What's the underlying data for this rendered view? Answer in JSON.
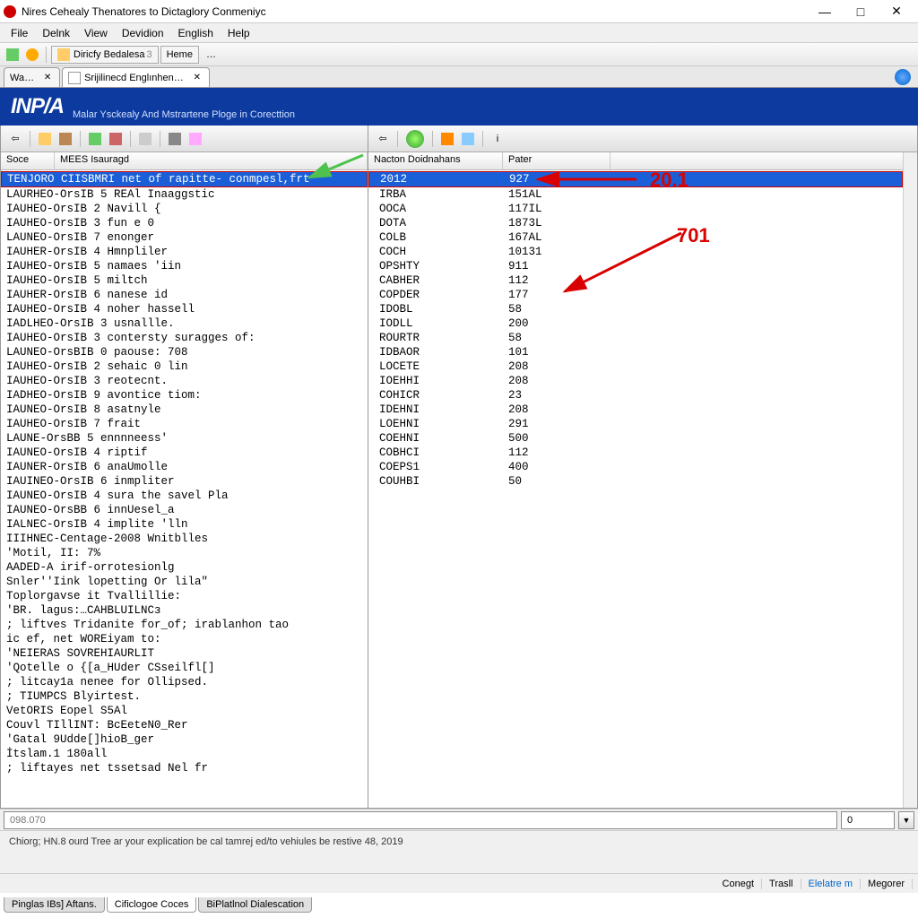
{
  "window": {
    "title": "Nires Cehealy Thenatores to Dictaglory Conmeniyc"
  },
  "menu": {
    "items": [
      "File",
      "Delnk",
      "View",
      "Devidion",
      "English",
      "Help"
    ]
  },
  "toolbar1": {
    "btn_label": "Diricfy Bedalesa",
    "btn_badge": "3",
    "home": "Heme",
    "dash": "…"
  },
  "tabs": {
    "t1": "Wa…",
    "t2": "Srijilinecd Englınhen…"
  },
  "banner": {
    "logo": "INP/A",
    "subtitle": "Malar Ysckealy And Mstrartene Ploge in Corecttion"
  },
  "left": {
    "header": {
      "col1": "Soce",
      "col2": "MEES   Isauragd"
    },
    "selected": "TENJORO CIISBMRI net of rapitte- conmpesl,frt",
    "rows": [
      "LAURHEO-OrsIB 5 REAl Inaaggstic",
      "IAUHEO-OrsIB 2 Navill {",
      "IAUHEO-OrsIB 3 fun e 0",
      "LAUNEO-OrsIB 7 enonger",
      "IAUHER-OrsIB 4 Hmnpliler",
      "IAUHEO-OrsIB 5 namaes 'iin",
      "IAUHEO-OrsIB 5 miltch",
      "IAUHER-OrsIB 6 nanese id",
      "IAUHEO-OrsIB 4 noher hassell",
      "IADLHEO-OrsIB 3 usnallle.",
      "IAUHEO-OrsIB 3 contersty suragges of:",
      "LAUNEO-OrsBIB 0 paouse: 708",
      "IAUHEO-OrsIB 2 sehaic 0 lin",
      "IAUHEO-OrsIB 3 reotecnt.",
      "IADHEO-OrsIB 9 avontice tiom:",
      "IAUNEO-OrsIB 8 asatnyle",
      "IAUHEO-OrsIB 7 frait",
      "LAUNE-OrsBB 5 ennnneess'",
      "IAUNEO-OrsIB 4 riptif",
      "IAUNER-OrsIB 6 anaUmolle",
      "IAUINEO-OrsIB 6 inmpliter",
      "IAUNEO-OrsIB 4 sura the savel Pla",
      "IAUNEO-OrsBB 6 innUesel_a",
      "IALNEC-OrsIB 4 implite 'lln",
      "IIIHNEC-Centage-2008 Wnitblles",
      "'Motil, II: 7%",
      "AADED-A irif-orrotesionlg",
      "Snler''Iink lopetting Or lila\"",
      "Toplorgavse it Tvallillie:",
      "'BR. lagus:…CAHBLUILNCз",
      "; liftves Tridanite for_of; irablanhon tao",
      "ic ef, net WOREiyam to:",
      "'NEIERAS SOVREHIAURLIT",
      "'Qotelle o {[a_HUder CSseilfl[]",
      "; litcay1a nenee for Ollipsed.",
      "; TIUMPCS Blyirtest.",
      "  VetORIS Eopel S5Al",
      "Couvl TIllINT: BcEeteN0_Rer",
      "'Gatal 9Udde[]hioB_ger",
      "İtslam.1 180all",
      "; liftayes net tssetsad Nel fr"
    ]
  },
  "right": {
    "header": {
      "col1": "Nacton Doidnahans",
      "col2": "Pater"
    },
    "selected": {
      "c1": "2012",
      "c2": "927"
    },
    "rows": [
      {
        "c1": "IRBA",
        "c2": "151AL"
      },
      {
        "c1": "OOCA",
        "c2": "117IL"
      },
      {
        "c1": "DOTA",
        "c2": "1873L"
      },
      {
        "c1": "COLB",
        "c2": "167AL"
      },
      {
        "c1": "COCH",
        "c2": "10131"
      },
      {
        "c1": "OPSHTY",
        "c2": "911"
      },
      {
        "c1": "CABHER",
        "c2": "112"
      },
      {
        "c1": "COPDER",
        "c2": "177"
      },
      {
        "c1": "IDOBL",
        "c2": "58"
      },
      {
        "c1": "IODLL",
        "c2": "200"
      },
      {
        "c1": "ROURTR",
        "c2": "58"
      },
      {
        "c1": "IDBAOR",
        "c2": "101"
      },
      {
        "c1": "LOCETE",
        "c2": "208"
      },
      {
        "c1": "IOEHHI",
        "c2": "208"
      },
      {
        "c1": "COHICR",
        "c2": "23"
      },
      {
        "c1": "IDEHNI",
        "c2": "208"
      },
      {
        "c1": "LOEHNI",
        "c2": "291"
      },
      {
        "c1": "COEHNI",
        "c2": "500"
      },
      {
        "c1": "COBHCI",
        "c2": "112"
      },
      {
        "c1": "COEPS1",
        "c2": "400"
      },
      {
        "c1": "COUHBI",
        "c2": "50"
      }
    ]
  },
  "status_input": {
    "placeholder": "098.070",
    "value": "0"
  },
  "log": {
    "text": "Chiorg; HN.8 ourd Tree ar your explication be cal tamrej ed/to vehiules be restive 48, 2019"
  },
  "bottom_tabs": {
    "t1": "Pinglas IBs] Aftans.",
    "t2": "Cificlogoe Coces",
    "t3": "BiPlatlnol Dialescation"
  },
  "bottom_status": {
    "s1": "Conegt",
    "s2": "Trasll",
    "s3": "Elelatre m",
    "s4": "Megorer"
  },
  "annotations": {
    "a1": "20.1",
    "a2": "701"
  },
  "colors": {
    "accent": "#1a5fd8",
    "banner": "#0d3a9e",
    "red": "#d80000",
    "green": "#4ec24c"
  }
}
